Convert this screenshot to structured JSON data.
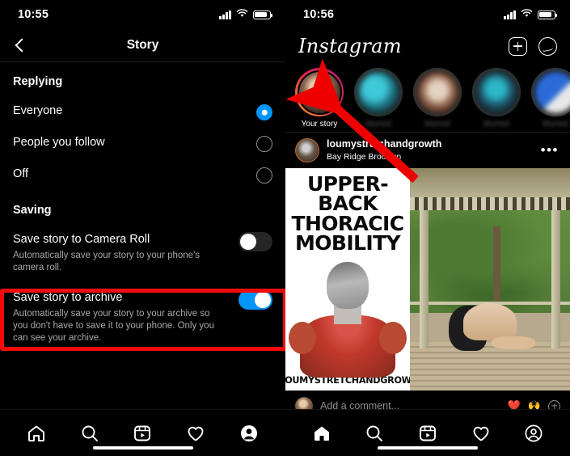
{
  "left_phone": {
    "status": {
      "time": "10:55",
      "signal_icon": "cellular-signal-icon",
      "wifi_icon": "wifi-icon",
      "battery_icon": "battery-icon"
    },
    "nav": {
      "back_icon": "chevron-left-icon",
      "title": "Story"
    },
    "sections": [
      {
        "header": "Replying",
        "type": "radio",
        "rows": [
          {
            "title": "Everyone",
            "selected": true
          },
          {
            "title": "People you follow",
            "selected": false
          },
          {
            "title": "Off",
            "selected": false
          }
        ]
      },
      {
        "header": "Saving",
        "type": "toggle",
        "rows": [
          {
            "title": "Save story to Camera Roll",
            "subtitle": "Automatically save your story to your phone's camera roll.",
            "on": false,
            "highlighted": false
          },
          {
            "title": "Save story to archive",
            "subtitle": "Automatically save your story to your archive so you don't have to save it to your phone. Only you can see your archive.",
            "on": true,
            "highlighted": true
          }
        ]
      }
    ],
    "tabbar": [
      {
        "name": "home",
        "icon": "home-icon",
        "active": false
      },
      {
        "name": "search",
        "icon": "search-icon",
        "active": false
      },
      {
        "name": "reels",
        "icon": "reels-icon",
        "active": false
      },
      {
        "name": "activity",
        "icon": "heart-icon",
        "active": false
      },
      {
        "name": "profile",
        "icon": "profile-avatar-icon",
        "active": true
      }
    ]
  },
  "right_phone": {
    "status": {
      "time": "10:56",
      "signal_icon": "cellular-signal-icon",
      "wifi_icon": "wifi-icon",
      "battery_icon": "battery-icon"
    },
    "header": {
      "logo": "Instagram",
      "add_icon": "plus-box-icon",
      "messenger_icon": "messenger-icon"
    },
    "stories": [
      {
        "label": "Your story",
        "blurred": false,
        "seen": false
      },
      {
        "label": "blurred",
        "blurred": true,
        "seen": true
      },
      {
        "label": "blurred",
        "blurred": true,
        "seen": true
      },
      {
        "label": "blurred",
        "blurred": true,
        "seen": true
      },
      {
        "label": "blurred",
        "blurred": true,
        "seen": true
      }
    ],
    "post": {
      "username": "loumystretchandgrowth",
      "location": "Bay Ridge Brooklyn",
      "more_icon": "more-options-icon",
      "media_text": {
        "line1": "UPPER-BACK",
        "line2": "THORACIC",
        "line3": "MOBILITY",
        "handle": "@LOUMYSTRETCHANDGROWTH"
      }
    },
    "comment_bar": {
      "placeholder": "Add a comment...",
      "emoji_1": "❤️",
      "emoji_2": "🙌",
      "add_icon": "plus-circle-icon"
    },
    "tabbar": [
      {
        "name": "home",
        "icon": "home-icon",
        "active": true
      },
      {
        "name": "search",
        "icon": "search-icon",
        "active": false
      },
      {
        "name": "reels",
        "icon": "reels-icon",
        "active": false
      },
      {
        "name": "activity",
        "icon": "heart-icon",
        "active": false
      },
      {
        "name": "profile",
        "icon": "profile-circle-icon",
        "active": false
      }
    ]
  },
  "annotations": {
    "highlight_color": "#f20a0a",
    "arrow_color": "#ee0000",
    "arrow_label": "red-arrow-pointing-to-your-story"
  },
  "colors": {
    "accent_blue": "#0095f6",
    "background": "#000000",
    "secondary_text": "#a8a8a8"
  }
}
